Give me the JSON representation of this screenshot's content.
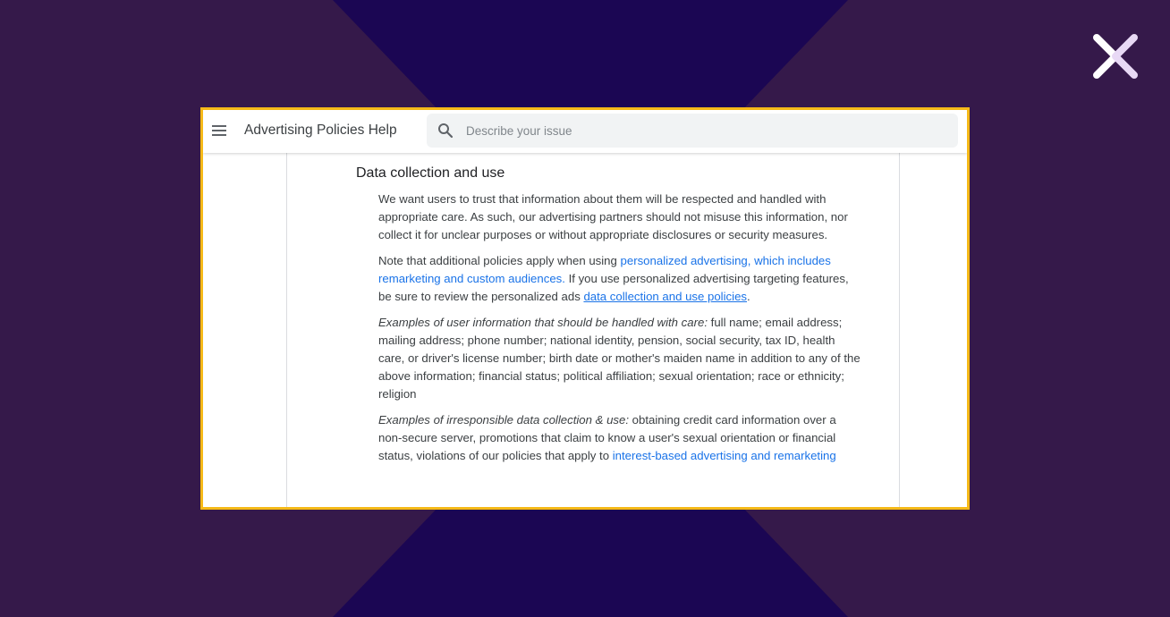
{
  "colors": {
    "page_background": "#35194a",
    "x_shape": "#1b0653",
    "frame_border": "#f5b918",
    "link": "#1a73e8",
    "logo": "#ffffff"
  },
  "brand": {
    "logo_icon": "x-logo-icon"
  },
  "header": {
    "menu_icon": "hamburger-menu-icon",
    "title": "Advertising Policies Help",
    "search": {
      "icon": "search-icon",
      "placeholder": "Describe your issue",
      "value": ""
    }
  },
  "article": {
    "section_title": "Data collection and use",
    "p1": "We want users to trust that information about them will be respected and handled with appropriate care. As such, our advertising partners should not misuse this information, nor collect it for unclear purposes or without appropriate disclosures or security measures.",
    "p2": {
      "text_before": "Note that additional policies apply when using ",
      "link1": "personalized advertising, which includes remarketing and custom audiences.",
      "text_middle": " If you use personalized advertising targeting features, be sure to review the personalized ads ",
      "link2": "data collection and use policies",
      "text_after": "."
    },
    "p3": {
      "lead": "Examples of user information that should be handled with care:",
      "text": " full name; email address; mailing address; phone number; national identity, pension, social security, tax ID, health care, or driver's license number; birth date or mother's maiden name in addition to any of the above information; financial status; political affiliation; sexual orientation; race or ethnicity; religion"
    },
    "p4": {
      "lead": "Examples of irresponsible data collection & use:",
      "text": " obtaining credit card information over a non-secure server, promotions that claim to know a user's sexual orientation or financial status, violations of our policies that apply to ",
      "link": "interest-based advertising and remarketing"
    }
  }
}
